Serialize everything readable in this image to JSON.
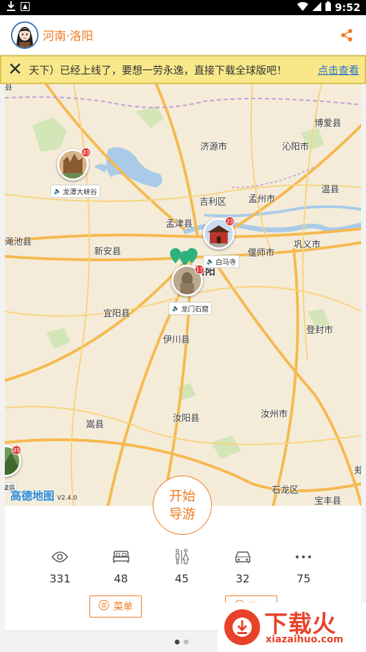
{
  "status_bar": {
    "time": "9:52"
  },
  "header": {
    "title": "河南·洛阳"
  },
  "notice": {
    "message": "天下）已经上线了，要想一劳永逸，直接下载全球版吧！",
    "download_link": "点击查看"
  },
  "map": {
    "labels": {
      "boai": "博爱县",
      "jiyuan": "济源市",
      "qinyang": "沁阳市",
      "wenxian": "温县",
      "jili": "吉利区",
      "mengzhou": "孟州市",
      "mengjin": "孟津县",
      "mianchi": "渑池县",
      "xinan": "新安县",
      "yanshi": "偃师市",
      "gongyi": "巩义市",
      "luoyang": "洛阳",
      "yiyang": "宜阳县",
      "dengfeng": "登封市",
      "yichuan": "伊川县",
      "songxian": "嵩县",
      "ruyang": "汝阳县",
      "ruzhou": "汝州市",
      "shilong": "石龙区",
      "baofeng": "宝丰县",
      "edge_top": "县",
      "edge_right": "郏"
    },
    "attribution": {
      "brand": "高德地图",
      "version": "V2.4.0"
    },
    "pois": {
      "longtan": {
        "name": "龙潭大峡谷",
        "count": "43"
      },
      "baima": {
        "name": "白马寺",
        "count": "23"
      },
      "longmen": {
        "name": "龙门石窟",
        "count": "17"
      },
      "edge": {
        "name": "黛眉",
        "count": "49"
      }
    }
  },
  "start_button": {
    "line1": "开始",
    "line2": "导游"
  },
  "stats": [
    {
      "icon": "eye-icon",
      "value": "331"
    },
    {
      "icon": "bed-icon",
      "value": "48"
    },
    {
      "icon": "restroom-icon",
      "value": "45"
    },
    {
      "icon": "car-icon",
      "value": "32"
    },
    {
      "icon": "more-icon",
      "value": "75"
    }
  ],
  "buttons": {
    "menu": "菜单",
    "second": "游记"
  },
  "watermark": {
    "big": "下载火",
    "small": "xiazaihuo.com"
  },
  "colors": {
    "accent": "#f07a20",
    "notice_bg": "#f8e88a",
    "link": "#2a74c9",
    "badge": "#e23b3b"
  }
}
